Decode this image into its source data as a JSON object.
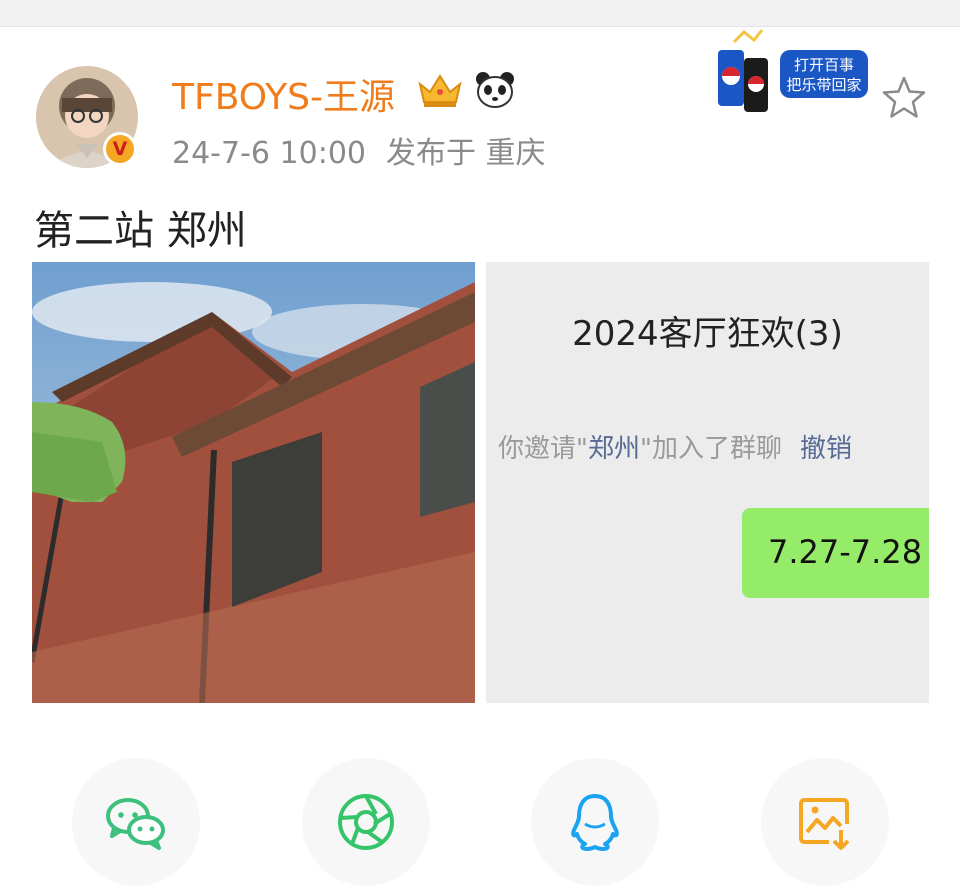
{
  "post": {
    "username": "TFBOYS-王源",
    "timestamp": "24-7-6 10:00",
    "location_prefix": "发布于",
    "location": "重庆",
    "text": "第二站 郑州"
  },
  "ad": {
    "text_line1": "打开百事",
    "text_line2": "把乐带回家"
  },
  "chat_screenshot": {
    "title": "2024客厅狂欢(3)",
    "notice_before": "你邀请\"",
    "notice_highlight": "郑州",
    "notice_after": "\"加入了群聊",
    "notice_action": "撤销",
    "bubble_text": "7.27-7.28"
  },
  "share_icons": [
    "wechat-icon",
    "moments-icon",
    "qq-icon",
    "save-image-icon"
  ],
  "colors": {
    "username": "#f07c1b",
    "meta": "#8a8a8a",
    "bubble": "#95ec69",
    "link": "#576b95",
    "wechat": "#3dbf7e",
    "moments": "#35c46a",
    "qq": "#1aa3f0",
    "save": "#f5a623"
  }
}
